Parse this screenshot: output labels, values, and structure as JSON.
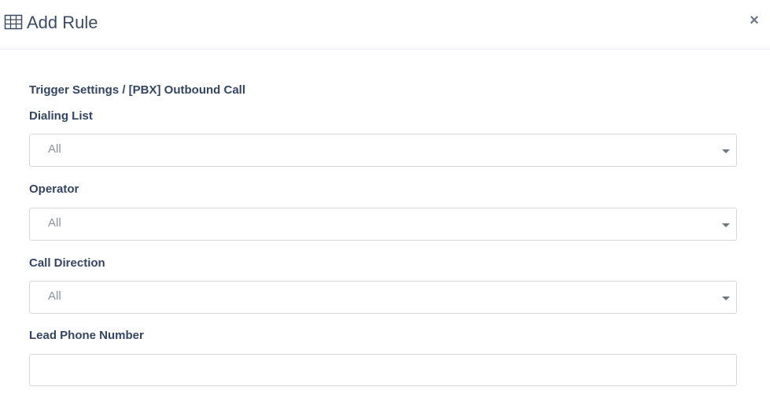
{
  "header": {
    "icon": "table-grid-icon",
    "title": "Add Rule",
    "close_label": "×"
  },
  "body": {
    "section_title": "Trigger Settings / [PBX] Outbound Call",
    "fields": [
      {
        "label": "Dialing List",
        "type": "select",
        "value": "All"
      },
      {
        "label": "Operator",
        "type": "select",
        "value": "All"
      },
      {
        "label": "Call Direction",
        "type": "select",
        "value": "All"
      },
      {
        "label": "Lead Phone Number",
        "type": "text",
        "value": "",
        "placeholder": ""
      }
    ]
  },
  "colors": {
    "text_primary": "#344563",
    "text_muted": "#8c939b",
    "border": "#d3d7dc"
  }
}
